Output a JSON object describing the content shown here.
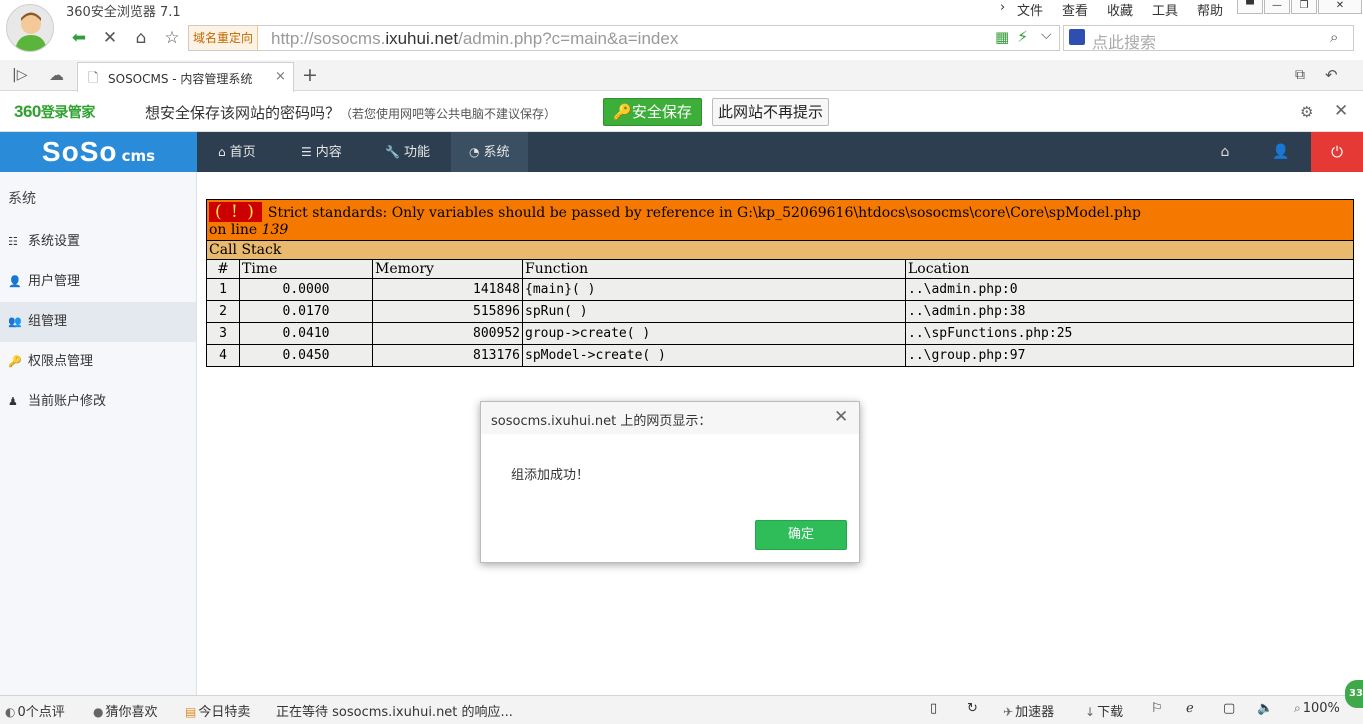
{
  "browser": {
    "app_title": "360安全浏览器 7.1",
    "menu": [
      "文件",
      "查看",
      "收藏",
      "工具",
      "帮助"
    ],
    "redirect_tag": "域名重定向",
    "url_prefix": "http://sosocms.",
    "url_domain": "ixuhui.net",
    "url_path": "/admin.php?c=main&a=index",
    "search_placeholder": "点此搜索",
    "tab_title": "SOSOCMS - 内容管理系统",
    "tab_close": "×",
    "new_tab": "+"
  },
  "password_bar": {
    "brand": "360",
    "brand_sub": "登录管家",
    "message": "想安全保存该网站的密码吗？",
    "hint": "（若您使用网吧等公共电脑不建议保存）",
    "save_label": "安全保存",
    "never_label": "此网站不再提示"
  },
  "cms": {
    "logo_main": "SoSo",
    "logo_sub": "cms",
    "nav": [
      {
        "label": "首页",
        "icon": "home-icon"
      },
      {
        "label": "内容",
        "icon": "list-icon"
      },
      {
        "label": "功能",
        "icon": "wrench-icon"
      },
      {
        "label": "系统",
        "icon": "dashboard-icon"
      }
    ],
    "active_nav": "系统"
  },
  "sidebar": {
    "title": "系统",
    "items": [
      {
        "label": "系统设置",
        "icon": "sliders-icon"
      },
      {
        "label": "用户管理",
        "icon": "user-icon"
      },
      {
        "label": "组管理",
        "icon": "users-icon"
      },
      {
        "label": "权限点管理",
        "icon": "key-icon"
      },
      {
        "label": "当前账户修改",
        "icon": "user-tie-icon"
      }
    ],
    "active": "组管理"
  },
  "error": {
    "icon": "( ! )",
    "message": "Strict standards: Only variables should be passed by reference in G:\\kp_52069616\\htdocs\\sosocms\\core\\Core\\spModel.php",
    "line_prefix": "on line",
    "line_no": "139",
    "stack_title": "Call Stack",
    "columns": [
      "#",
      "Time",
      "Memory",
      "Function",
      "Location"
    ],
    "rows": [
      {
        "n": "1",
        "time": "0.0000",
        "memory": "141848",
        "func": "{main}( )",
        "loc": "..\\admin.php:0"
      },
      {
        "n": "2",
        "time": "0.0170",
        "memory": "515896",
        "func": "spRun( )",
        "loc": "..\\admin.php:38"
      },
      {
        "n": "3",
        "time": "0.0410",
        "memory": "800952",
        "func": "group->create( )",
        "loc": "..\\spFunctions.php:25"
      },
      {
        "n": "4",
        "time": "0.0450",
        "memory": "813176",
        "func": "spModel->create( )",
        "loc": "..\\group.php:97"
      }
    ]
  },
  "dialog": {
    "title": "sosocms.ixuhui.net 上的网页显示：",
    "message": "组添加成功！",
    "ok_label": "确定"
  },
  "status": {
    "comments": "0个点评",
    "guess": "猜你喜欢",
    "daily": "今日特卖",
    "loading": "正在等待 sosocms.ixuhui.net 的响应...",
    "accelerator": "加速器",
    "download": "下载",
    "zoom": "100%",
    "badge": "33"
  },
  "colors": {
    "cms_header": "#2c3e50",
    "logo_bg": "#2a8bd8",
    "power": "#e53935",
    "error_orange": "#f57900",
    "stack_tan": "#e9b96e",
    "ok_green": "#2ebd59",
    "save_green": "#3eae3a"
  }
}
